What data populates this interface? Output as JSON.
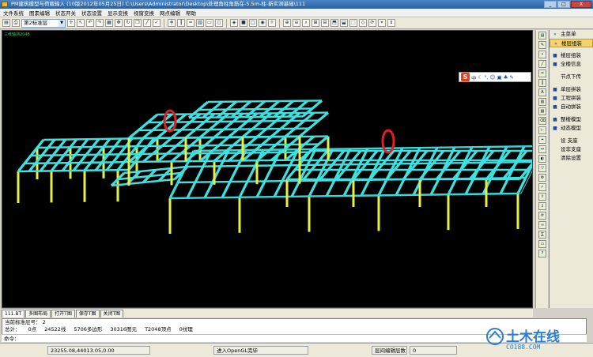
{
  "window": {
    "title": "PM建筑模型与荷载输入 (10版2012年05月25日) C:\\Users\\Administrator\\Desktop\\处理角柱角筋在-5.5m-柱-新实测基础\\111",
    "controls": [
      "_",
      "□",
      "X"
    ]
  },
  "menu": {
    "items": [
      "文件系统",
      "图素编辑",
      "状态开关",
      "状态设置",
      "显示变换",
      "视窗变换",
      "网点编辑",
      "帮助"
    ]
  },
  "toolbar": {
    "layer_value": "第2标准层",
    "icons": [
      "save-icon",
      "print-icon"
    ]
  },
  "canvas": {
    "corner_label": "三维轴测2048",
    "beam_color": "#3ee0e0",
    "column_color": "#e8f040",
    "ground_color": "#2fd0d0",
    "highlight_color": "#e02020"
  },
  "ime": {
    "logo": "S",
    "items": [
      "中",
      "☾",
      "°,",
      "☺",
      "▣",
      "♣",
      "✎"
    ]
  },
  "side_panel": {
    "items": [
      {
        "label": "主菜单",
        "marker": "»",
        "selected": false
      },
      {
        "label": "楼层组装",
        "marker": "»",
        "selected": true
      },
      {
        "label": "楼层组装",
        "marker": "■",
        "selected": false
      },
      {
        "label": "全楼信息",
        "marker": "■",
        "selected": false
      },
      {
        "label": "节点下传",
        "marker": "",
        "selected": false
      },
      {
        "label": "单层拼装",
        "marker": "■",
        "selected": false
      },
      {
        "label": "工程拼装",
        "marker": "■",
        "selected": false
      },
      {
        "label": "自动拼装",
        "marker": "■",
        "selected": false
      },
      {
        "label": "整楼模型",
        "marker": "■",
        "selected": false
      },
      {
        "label": "动态模型",
        "marker": "■",
        "selected": false
      },
      {
        "label": "设 支座",
        "marker": "",
        "selected": false
      },
      {
        "label": "设非支座",
        "marker": "",
        "selected": false
      },
      {
        "label": "清除设置",
        "marker": "",
        "selected": false
      }
    ]
  },
  "tabs": [
    "111.BT",
    "多图布局",
    "打开T图",
    "保存T图",
    "关闭T图"
  ],
  "info": {
    "line1": "当前标准层号： 2",
    "totals_label": "总计：",
    "totals": [
      "0点",
      "24522线",
      "5706多边形",
      "30316图元",
      "T2048顶点",
      "0纹理"
    ],
    "cmd_label": "命令："
  },
  "status": {
    "coords": "23255.08,44013.05,0.00",
    "mode": "进入OpenGL完毕",
    "layer_info": "层间编辑层数",
    "layer_count": "0"
  },
  "watermark": {
    "main": "土木在线",
    "sub": "CO188.COM"
  }
}
